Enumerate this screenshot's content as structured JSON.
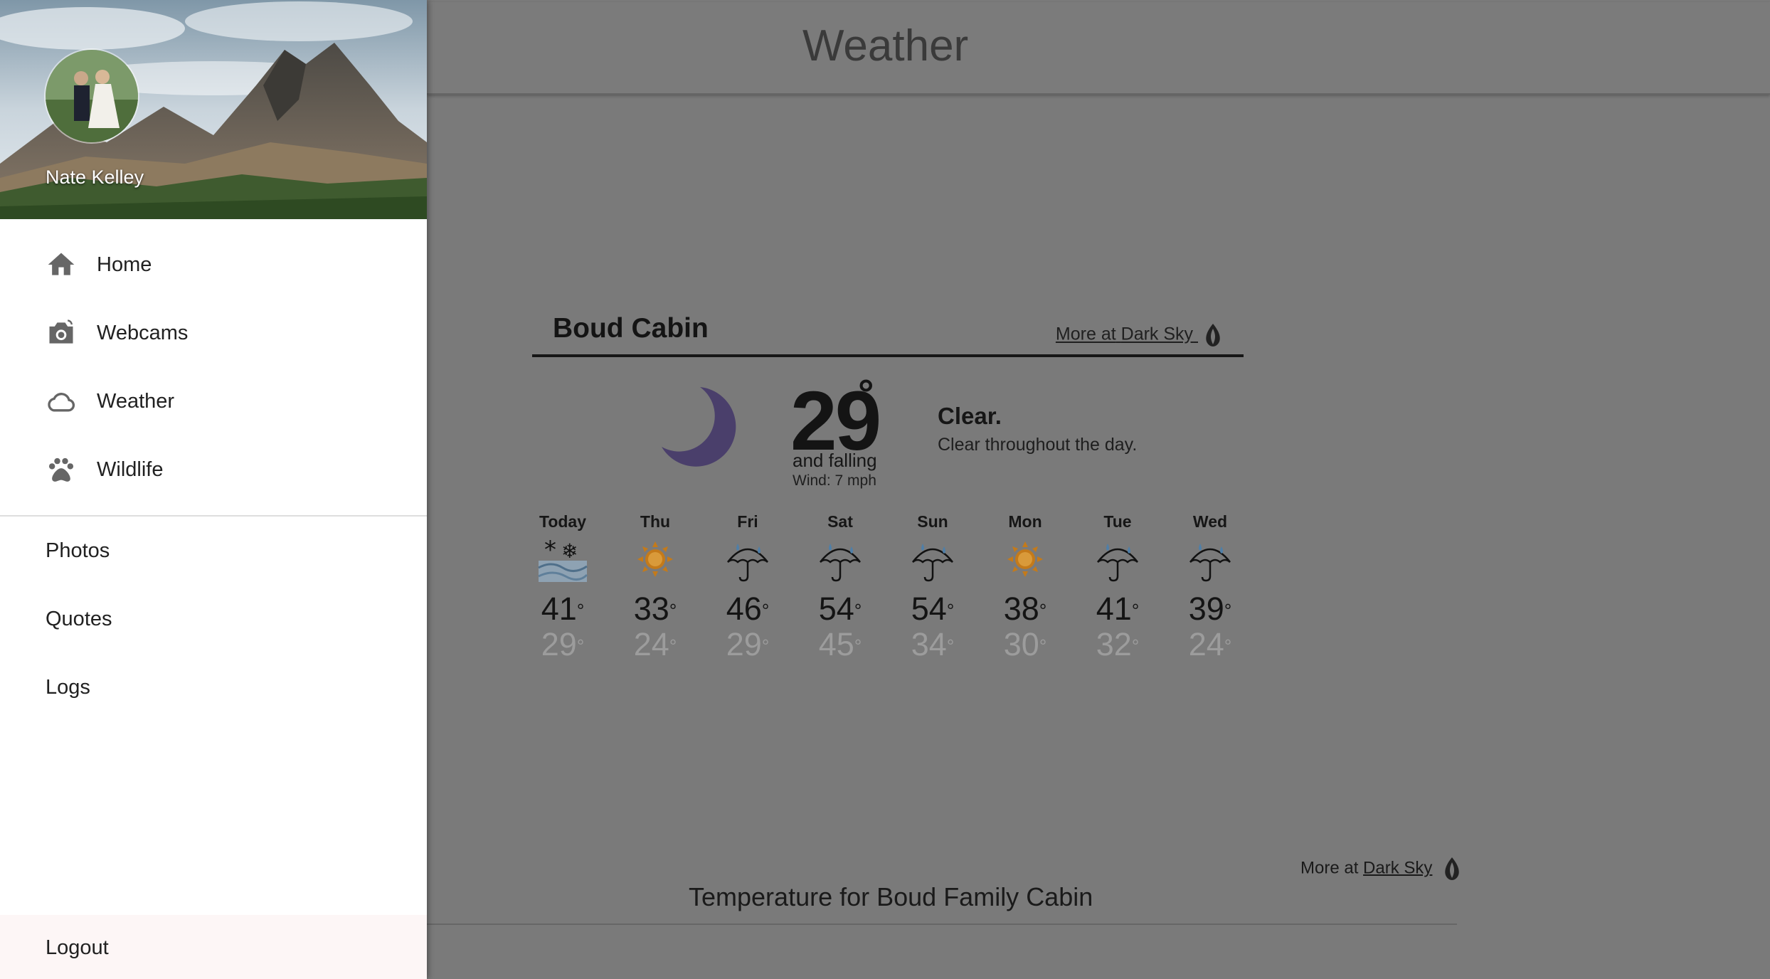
{
  "page": {
    "title": "Weather"
  },
  "user": {
    "name": "Nate Kelley"
  },
  "nav": {
    "primary": [
      {
        "label": "Home",
        "icon": "home-icon"
      },
      {
        "label": "Webcams",
        "icon": "camera-icon"
      },
      {
        "label": "Weather",
        "icon": "cloud-icon"
      },
      {
        "label": "Wildlife",
        "icon": "paw-icon"
      }
    ],
    "secondary": [
      {
        "label": "Photos"
      },
      {
        "label": "Quotes"
      },
      {
        "label": "Logs"
      }
    ],
    "logout_label": "Logout"
  },
  "weather": {
    "location": "Boud Cabin",
    "more_prefix": "More at",
    "more_link": "Dark Sky",
    "current": {
      "temp": "29",
      "degree": "°",
      "trend": "and falling",
      "wind": "Wind: 7 mph",
      "summary": "Clear.",
      "summary_detail": "Clear throughout the day.",
      "icon": "moon-icon"
    },
    "forecast": [
      {
        "day": "Today",
        "hi": "41",
        "lo": "29",
        "icon": "snow-icon"
      },
      {
        "day": "Thu",
        "hi": "33",
        "lo": "24",
        "icon": "sun-icon"
      },
      {
        "day": "Fri",
        "hi": "46",
        "lo": "29",
        "icon": "umbrella-icon"
      },
      {
        "day": "Sat",
        "hi": "54",
        "lo": "45",
        "icon": "umbrella-icon"
      },
      {
        "day": "Sun",
        "hi": "54",
        "lo": "34",
        "icon": "umbrella-icon"
      },
      {
        "day": "Mon",
        "hi": "38",
        "lo": "30",
        "icon": "sun-icon"
      },
      {
        "day": "Tue",
        "hi": "41",
        "lo": "32",
        "icon": "umbrella-icon"
      },
      {
        "day": "Wed",
        "hi": "39",
        "lo": "24",
        "icon": "umbrella-icon"
      }
    ]
  },
  "footer": {
    "more_prefix": "More at",
    "more_link": "Dark Sky",
    "chart_title": "Temperature for Boud Family Cabin"
  },
  "colors": {
    "overlay": "#7a7a7a",
    "moon": "#4a3f6b",
    "sun": "#c47a1a",
    "raindrop": "#4f7fa8"
  }
}
